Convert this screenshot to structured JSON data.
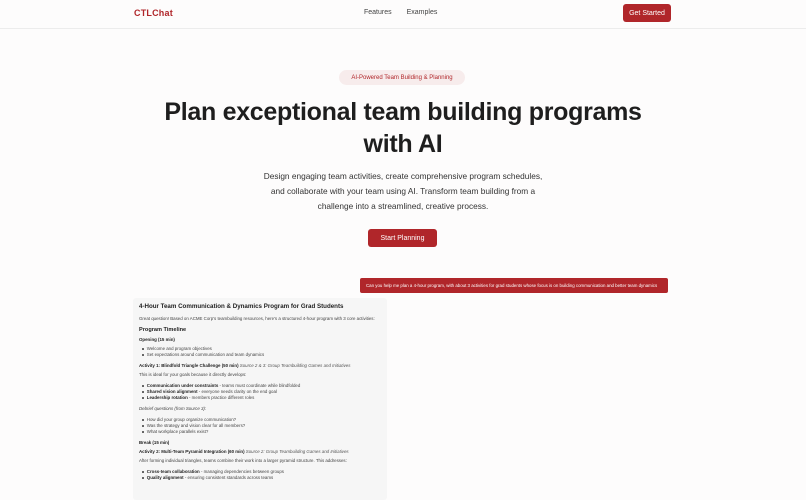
{
  "nav": {
    "logo": "CTLChat",
    "links": [
      "Features",
      "Examples"
    ],
    "cta": "Get Started"
  },
  "hero": {
    "badge": "AI-Powered Team Building & Planning",
    "title_line1": "Plan exceptional team building programs",
    "title_line2": "with AI",
    "subtitle_line1": "Design engaging team activities, create comprehensive program schedules,",
    "subtitle_line2": "and collaborate with your team using AI. Transform team building from a",
    "subtitle_line3": "challenge into a streamlined, creative process.",
    "cta": "Start Planning"
  },
  "chat": {
    "user_message": "Can you help me plan a 4-hour program, with about 3 activities for grad students whose focus is on building communication and better team dynamics",
    "ai": {
      "title": "4-Hour Team Communication & Dynamics Program for Grad Students",
      "intro": "Great question! Based on ACME Corp's teambuilding resources, here's a structured 4-hour program with 3 core activities:",
      "timeline_heading": "Program Timeline",
      "opening_label": "Opening (15 min)",
      "opening_items": [
        "Welcome and program objectives",
        "Set expectations around communication and team dynamics"
      ],
      "activity1_label": "Activity 1: Blindfold Triangle Challenge (50 min)",
      "activity1_source": "Source 2 & 3: Group Teambuilding Games and Initiatives",
      "activity1_note": "This is ideal for your goals because it directly develops:",
      "activity1_items": [
        {
          "b": "Communication under constraints",
          "t": " - teams must coordinate while blindfolded"
        },
        {
          "b": "Shared vision alignment",
          "t": " - everyone needs clarity on the end goal"
        },
        {
          "b": "Leadership rotation",
          "t": " - members practice different roles"
        }
      ],
      "debrief_label": "Debrief questions (from Source 3):",
      "debrief_items": [
        "How did your group organize communication?",
        "Was the strategy and vision clear for all members?",
        "What workplace parallels exist?"
      ],
      "break_label": "Break (15 min)",
      "activity2_label": "Activity 2: Multi-Team Pyramid Integration (60 min)",
      "activity2_source": "Source 2: Group Teambuilding Games and Initiatives",
      "activity2_note": "After forming individual triangles, teams combine their work into a larger pyramid structure. This addresses:",
      "activity2_items": [
        {
          "b": "Cross-team collaboration",
          "t": " - managing dependencies between groups"
        },
        {
          "b": "Quality alignment",
          "t": " - ensuring consistent standards across teams"
        }
      ]
    }
  }
}
